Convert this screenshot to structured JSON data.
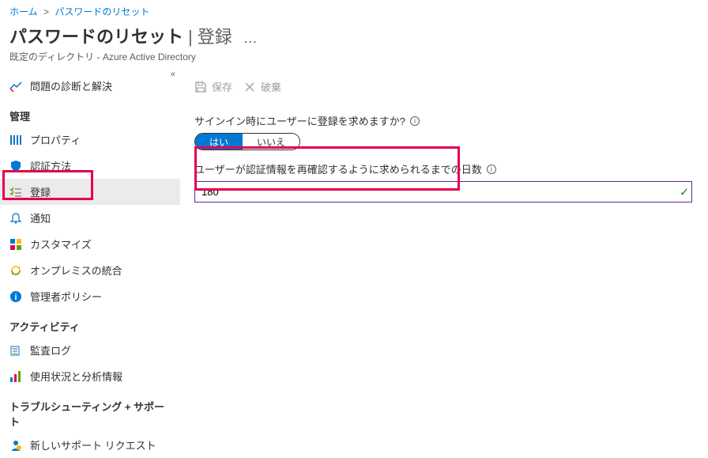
{
  "breadcrumb": {
    "home": "ホーム",
    "reset": "パスワードのリセット"
  },
  "header": {
    "title_main": "パスワードのリセット",
    "title_sub": "登録",
    "subtitle": "既定のディレクトリ - Azure Active Directory"
  },
  "toolbar": {
    "save": "保存",
    "discard": "破棄"
  },
  "sidebar": {
    "diagnose": "問題の診断と解決",
    "section_manage": "管理",
    "properties": "プロパティ",
    "auth_methods": "認証方法",
    "registration": "登録",
    "notification": "通知",
    "customize": "カスタマイズ",
    "onprem": "オンプレミスの統合",
    "admin_policy": "管理者ポリシー",
    "section_activity": "アクティビティ",
    "audit_logs": "監査ログ",
    "usage": "使用状況と分析情報",
    "section_trouble": "トラブルシューティング + サポート",
    "support": "新しいサポート リクエスト"
  },
  "form": {
    "require_register_label": "サインイン時にユーザーに登録を求めますか?",
    "require_register_yes": "はい",
    "require_register_no": "いいえ",
    "days_label": "ユーザーが認証情報を再確認するように求められるまでの日数",
    "days_value": "180"
  }
}
